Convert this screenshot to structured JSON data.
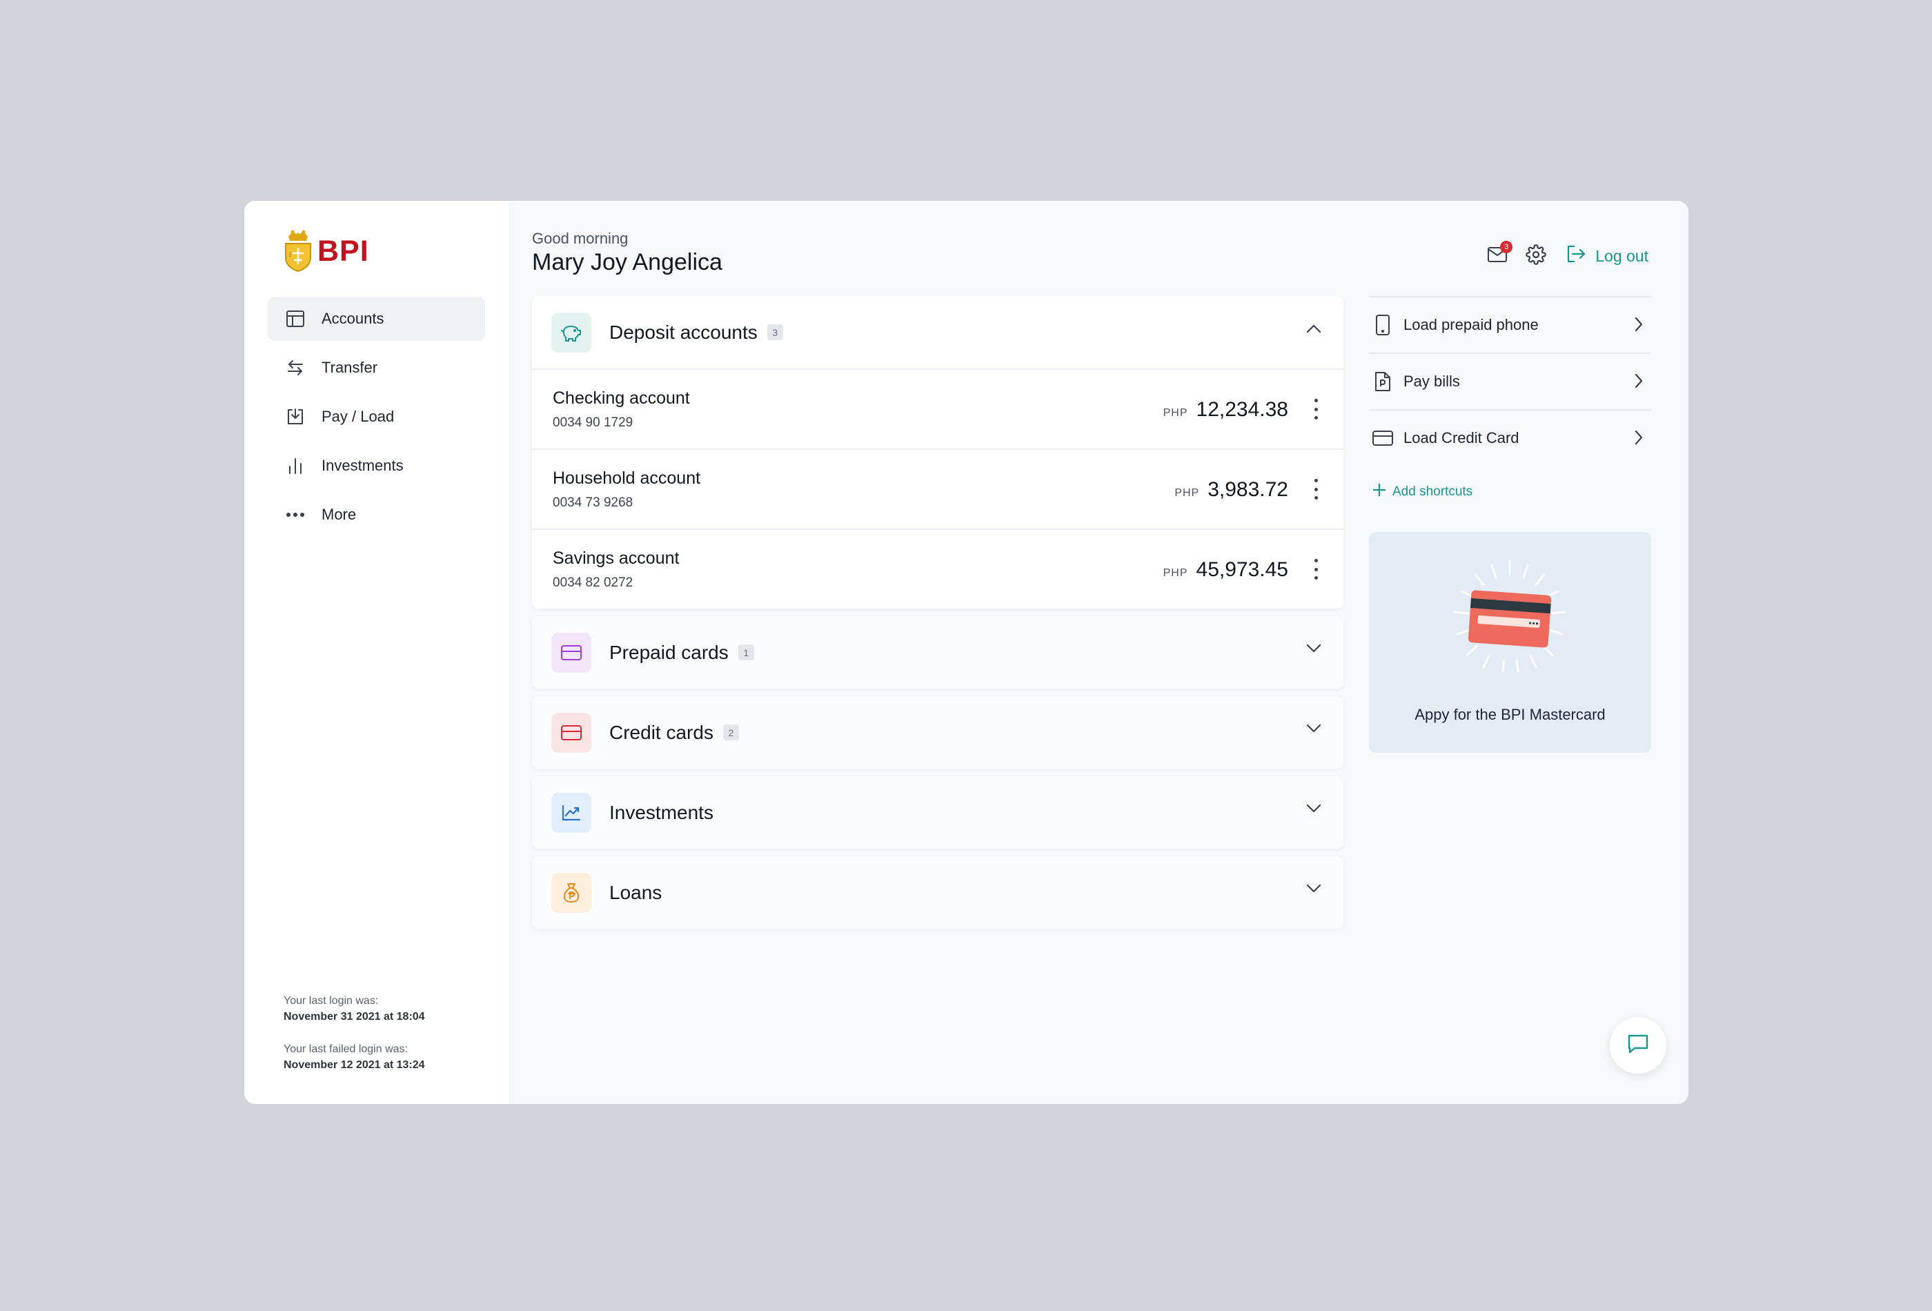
{
  "brand": {
    "name": "BPI",
    "color": "#c1121f",
    "accent": "#16978a"
  },
  "sidebar": {
    "items": [
      {
        "label": "Accounts",
        "icon": "layout-icon",
        "active": true
      },
      {
        "label": "Transfer",
        "icon": "transfer-arrows-icon"
      },
      {
        "label": "Pay / Load",
        "icon": "download-tray-icon"
      },
      {
        "label": "Investments",
        "icon": "bar-chart-icon"
      },
      {
        "label": "More",
        "icon": "more-dots-icon"
      }
    ],
    "last_login_label": "Your last login was:",
    "last_login_value": "November 31 2021 at 18:04",
    "last_failed_label": "Your last failed login was:",
    "last_failed_value": "November 12 2021 at 13:24"
  },
  "header": {
    "greeting": "Good morning",
    "user_name": "Mary Joy Angelica",
    "mail_badge": "3",
    "logout_label": "Log out"
  },
  "accounts": {
    "deposit": {
      "title": "Deposit accounts",
      "count": "3",
      "rows": [
        {
          "name": "Checking account",
          "number": "0034 90 1729",
          "currency": "PHP",
          "amount": "12,234.38"
        },
        {
          "name": "Household account",
          "number": "0034 73 9268",
          "currency": "PHP",
          "amount": "3,983.72"
        },
        {
          "name": "Savings account",
          "number": "0034 82 0272",
          "currency": "PHP",
          "amount": "45,973.45"
        }
      ]
    },
    "prepaid": {
      "title": "Prepaid cards",
      "count": "1"
    },
    "credit": {
      "title": "Credit cards",
      "count": "2"
    },
    "investments": {
      "title": "Investments"
    },
    "loans": {
      "title": "Loans"
    }
  },
  "shortcuts": {
    "items": [
      {
        "label": "Load prepaid phone",
        "icon": "phone-icon"
      },
      {
        "label": "Pay bills",
        "icon": "bill-document-icon"
      },
      {
        "label": "Load Credit Card",
        "icon": "credit-card-icon"
      }
    ],
    "add_label": "Add shortcuts"
  },
  "promo": {
    "text": "Appy for the BPI Mastercard"
  }
}
